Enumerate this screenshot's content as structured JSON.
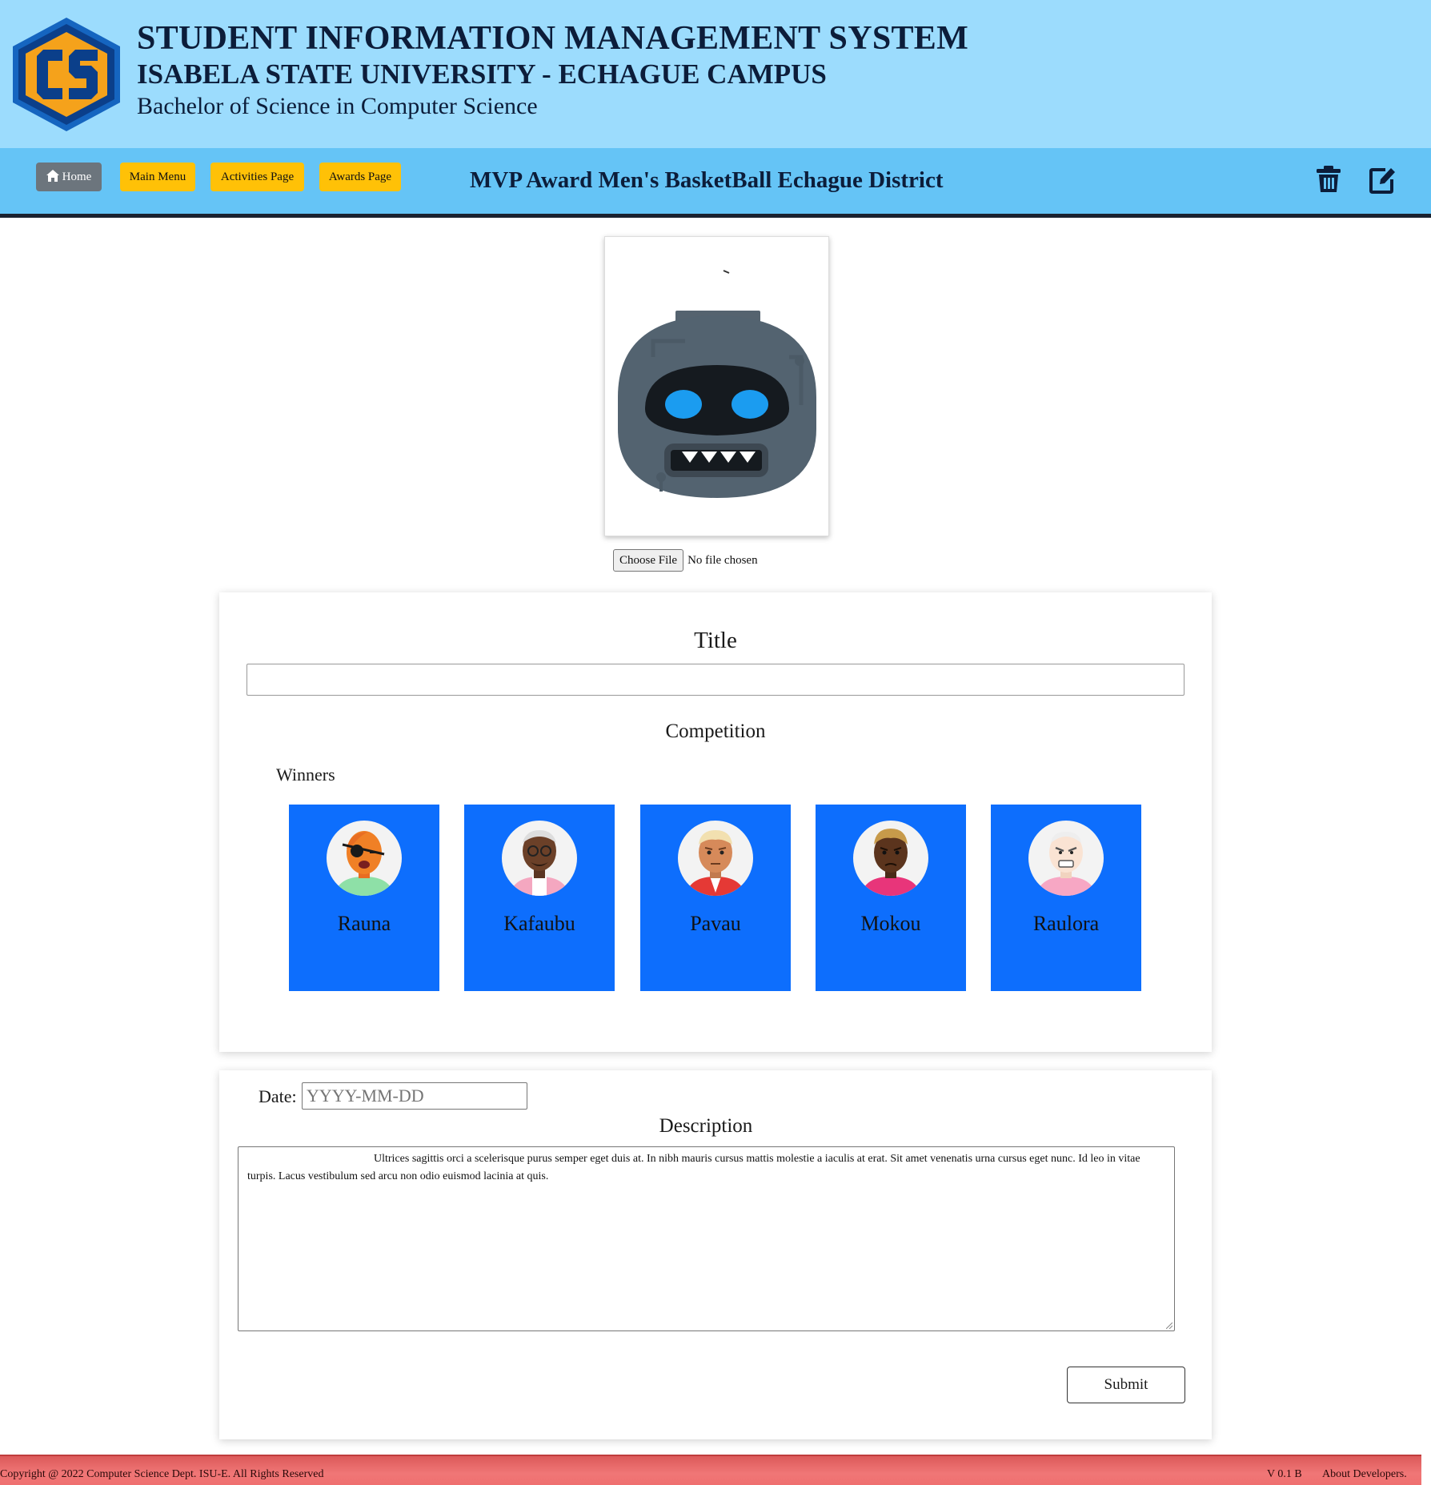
{
  "header": {
    "line1": "STUDENT INFORMATION MANAGEMENT SYSTEM",
    "line2": "ISABELA STATE UNIVERSITY - ECHAGUE CAMPUS",
    "line3": "Bachelor of Science in Computer Science",
    "logo_colors": {
      "primary": "#1565c0",
      "accent": "#f5a21b"
    }
  },
  "nav": {
    "home_label": "Home",
    "main_menu_label": "Main Menu",
    "activities_label": "Activities Page",
    "awards_label": "Awards Page",
    "page_title": "MVP Award Men's BasketBall Echague District",
    "icons": [
      "home-icon",
      "trash-icon",
      "edit-icon"
    ]
  },
  "photo": {
    "choose_file_label": "Choose File",
    "file_status": "No file chosen"
  },
  "form": {
    "title_label": "Title",
    "title_value": "",
    "competition_label": "Competition",
    "winners_label": "Winners",
    "winners": [
      {
        "name": "Rauna"
      },
      {
        "name": "Kafaubu"
      },
      {
        "name": "Pavau"
      },
      {
        "name": "Mokou"
      },
      {
        "name": "Raulora"
      }
    ],
    "winner_card_color": "#0d6efd",
    "date_label": "Date:",
    "date_placeholder": "YYYY-MM-DD",
    "description_label": "Description",
    "description_text": "Ultrices sagittis orci a scelerisque purus semper eget duis at. In nibh mauris cursus mattis molestie a iaculis at erat. Sit amet venenatis urna cursus eget nunc. Id leo in vitae turpis. Lacus vestibulum sed arcu non odio euismod lacinia at quis.",
    "submit_label": "Submit"
  },
  "footer": {
    "copyright": "Copyright @ 2022 Computer Science Dept. ISU-E. All Rights Reserved",
    "version": "V 0.1 B",
    "about": "About Developers."
  }
}
